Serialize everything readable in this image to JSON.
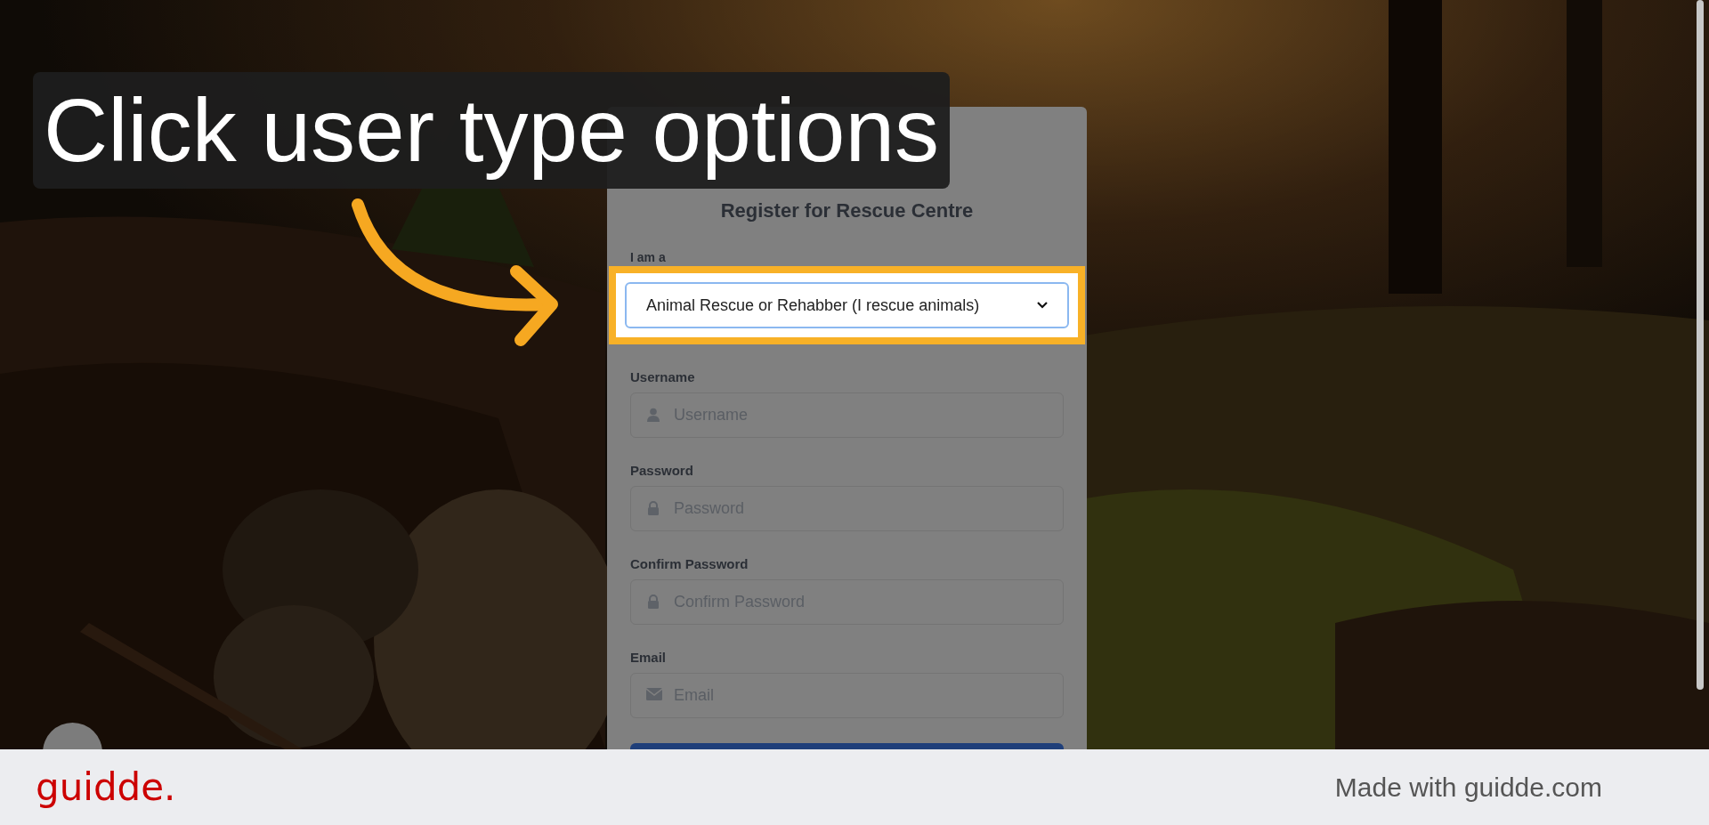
{
  "caption": "Click user type options",
  "form": {
    "title": "Register for Rescue Centre",
    "user_type": {
      "label": "I am a",
      "value": "Animal Rescue or Rehabber (I rescue animals)",
      "highlighted": true
    },
    "fields": [
      {
        "label": "Username",
        "placeholder": "Username",
        "kind": "user"
      },
      {
        "label": "Password",
        "placeholder": "Password",
        "kind": "lock"
      },
      {
        "label": "Confirm Password",
        "placeholder": "Confirm Password",
        "kind": "lock"
      },
      {
        "label": "Email",
        "placeholder": "Email",
        "kind": "mail"
      }
    ]
  },
  "footer": {
    "logo": "guidde.",
    "credit": "Made with guidde.com"
  }
}
